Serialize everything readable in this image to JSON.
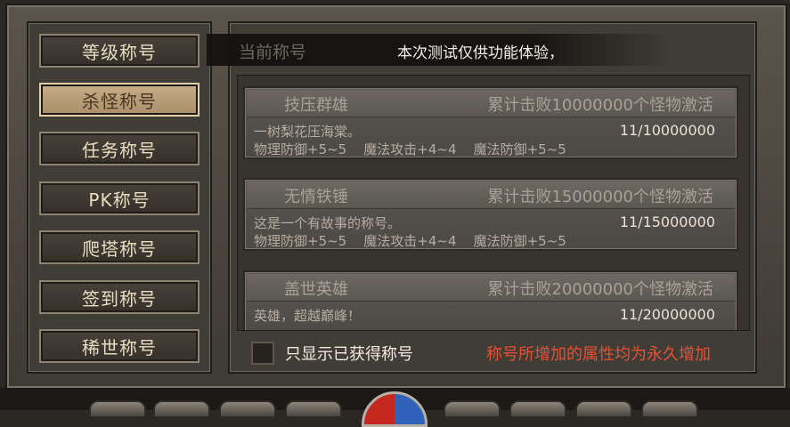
{
  "tabs": [
    {
      "label": "等级称号",
      "active": false
    },
    {
      "label": "杀怪称号",
      "active": true
    },
    {
      "label": "任务称号",
      "active": false
    },
    {
      "label": "PK称号",
      "active": false
    },
    {
      "label": "爬塔称号",
      "active": false
    },
    {
      "label": "签到称号",
      "active": false
    },
    {
      "label": "稀世称号",
      "active": false
    }
  ],
  "notice": {
    "label": "当前称号",
    "text": "本次测试仅供功能体验，"
  },
  "titles": [
    {
      "name": "技压群雄",
      "condition": "累计击败10000000个怪物激活",
      "description": "一树梨花压海棠。",
      "progress": "11/10000000",
      "attributes": "物理防御+5~5    魔法攻击+4~4    魔法防御+5~5"
    },
    {
      "name": "无情铁锤",
      "condition": "累计击败15000000个怪物激活",
      "description": "这是一个有故事的称号。",
      "progress": "11/15000000",
      "attributes": "物理防御+5~5    魔法攻击+4~4    魔法防御+5~5"
    },
    {
      "name": "盖世英雄",
      "condition": "累计击败20000000个怪物激活",
      "description": "英雄，超越巅峰！",
      "progress": "11/20000000",
      "attributes": ""
    }
  ],
  "filter": {
    "label": "只显示已获得称号",
    "checked": false
  },
  "footer_note": "称号所增加的属性均为永久增加",
  "colors": {
    "footer_note": "#e65135",
    "active_tab": "#c5ad88"
  }
}
